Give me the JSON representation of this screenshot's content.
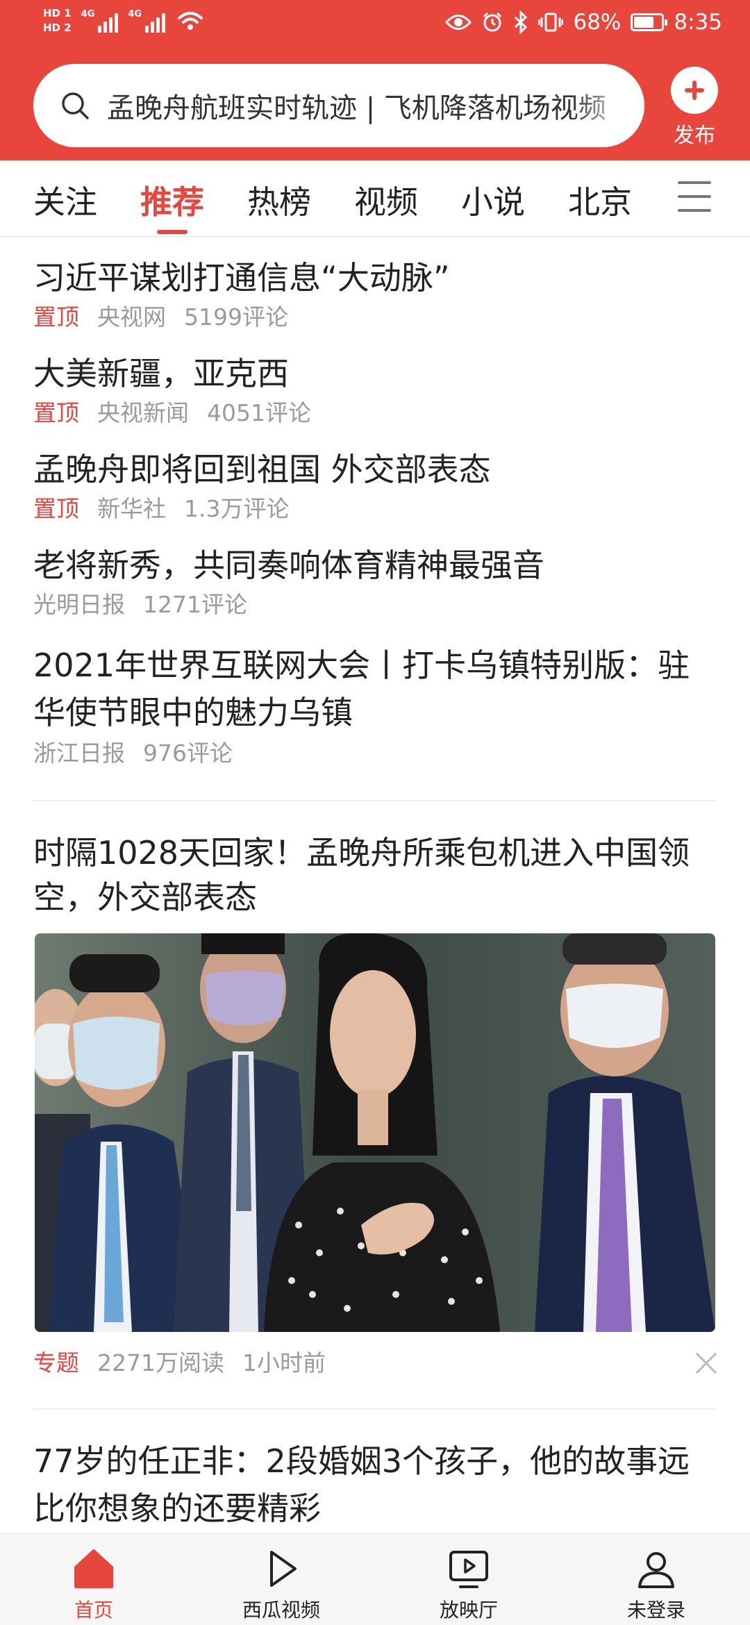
{
  "status_bar": {
    "hd1": "HD 1",
    "hd2": "HD 2",
    "net1": "4G",
    "net2": "4G",
    "battery": "68%",
    "time": "8:35"
  },
  "search": {
    "text": "孟晚舟航班实时轨迹 | 飞机降落机场视频"
  },
  "publish_label": "发布",
  "tabs": [
    "关注",
    "推荐",
    "热榜",
    "视频",
    "小说",
    "北京"
  ],
  "active_tab": "推荐",
  "feed": [
    {
      "title": "习近平谋划打通信息“大动脉”",
      "pin": "置顶",
      "source": "央视网",
      "comments": "5199评论"
    },
    {
      "title": "大美新疆，亚克西",
      "pin": "置顶",
      "source": "央视新闻",
      "comments": "4051评论"
    },
    {
      "title": "孟晚舟即将回到祖国 外交部表态",
      "pin": "置顶",
      "source": "新华社",
      "comments": "1.3万评论"
    },
    {
      "title": "老将新秀，共同奏响体育精神最强音",
      "source": "光明日报",
      "comments": "1271评论"
    },
    {
      "title": "2021年世界互联网大会丨打卡乌镇特别版：驻华使节眼中的魅力乌镇",
      "source": "浙江日报",
      "comments": "976评论"
    }
  ],
  "feature": {
    "title": "时隔1028天回家！孟晚舟所乘包机进入中国领空，外交部表态",
    "tag": "专题",
    "reads": "2271万阅读",
    "time": "1小时前"
  },
  "next_item": {
    "title": "77岁的任正非：2段婚姻3个孩子，他的故事远比你想象的还要精彩"
  },
  "bottom_nav": [
    "首页",
    "西瓜视频",
    "放映厅",
    "未登录"
  ],
  "colors": {
    "brand": "#e8453c",
    "meta": "#9a9a9a"
  }
}
